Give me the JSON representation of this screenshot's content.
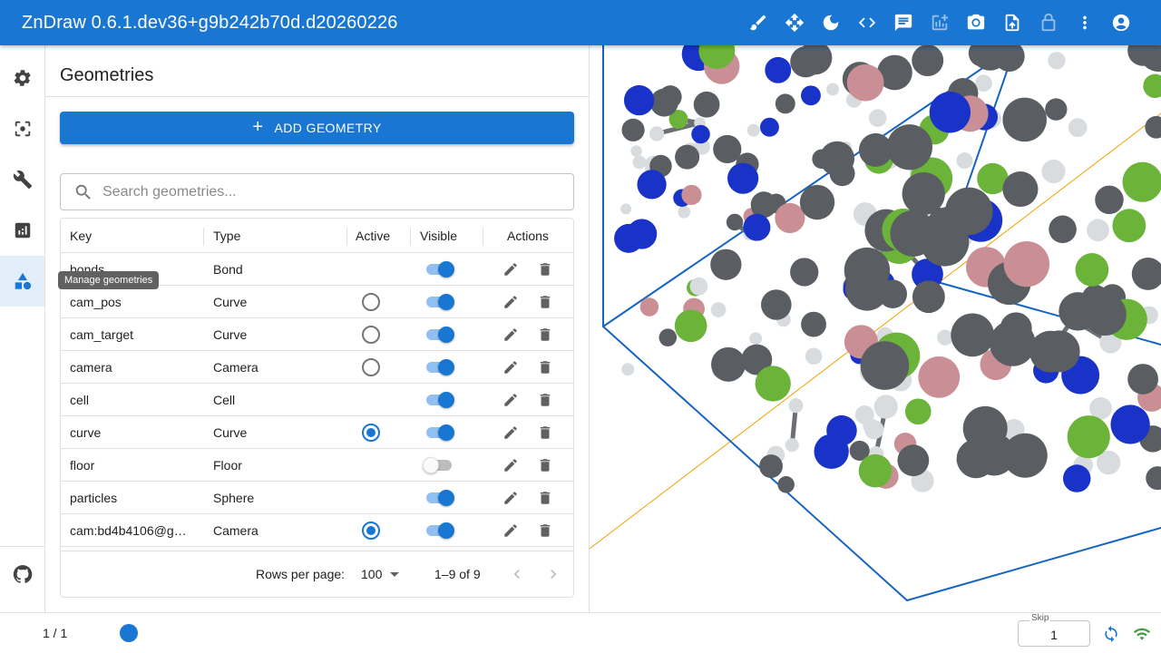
{
  "app": {
    "title": "ZnDraw 0.6.1.dev36+g9b242b70d.d20260226"
  },
  "toolbar": {
    "icons": [
      "brush-icon",
      "move-icon",
      "dark-mode-icon",
      "code-icon",
      "chat-icon",
      "add-chart-icon",
      "camera-icon",
      "upload-icon",
      "lock-icon",
      "more-vert-icon",
      "account-icon"
    ]
  },
  "rail": {
    "items": [
      "settings-icon",
      "center-focus-icon",
      "wrench-icon",
      "analytics-icon",
      "geometries-icon"
    ],
    "active": "geometries-icon",
    "tooltip": "Manage geometries"
  },
  "panel": {
    "title": "Geometries",
    "add_label": "ADD GEOMETRY",
    "search_placeholder": "Search geometries..."
  },
  "table": {
    "columns": {
      "key": "Key",
      "type": "Type",
      "active": "Active",
      "visible": "Visible",
      "actions": "Actions"
    },
    "rows": [
      {
        "key": "bonds",
        "type": "Bond",
        "active": null,
        "visible": true
      },
      {
        "key": "cam_pos",
        "type": "Curve",
        "active": false,
        "visible": true
      },
      {
        "key": "cam_target",
        "type": "Curve",
        "active": false,
        "visible": true
      },
      {
        "key": "camera",
        "type": "Camera",
        "active": false,
        "visible": true
      },
      {
        "key": "cell",
        "type": "Cell",
        "active": null,
        "visible": true
      },
      {
        "key": "curve",
        "type": "Curve",
        "active": true,
        "visible": true
      },
      {
        "key": "floor",
        "type": "Floor",
        "active": null,
        "visible": false
      },
      {
        "key": "particles",
        "type": "Sphere",
        "active": null,
        "visible": true
      },
      {
        "key": "cam:bd4b4106@g…",
        "type": "Camera",
        "active": true,
        "visible": true
      }
    ],
    "footer": {
      "rows_per_page_label": "Rows per page:",
      "rows_per_page": "100",
      "range": "1–9 of 9"
    }
  },
  "bottom": {
    "frame": "1 / 1",
    "progress": 0.0,
    "skip_label": "Skip",
    "skip_value": "1",
    "colors": {
      "sync": "#1976d2",
      "wifi": "#43a047"
    }
  },
  "scene": {
    "atom_colors": {
      "carbon": "#5a5e63",
      "hydrogen": "#d9dcdf",
      "nitrogen": "#1932c8",
      "fluorine": "#6cb33a",
      "boron": "#c98f95"
    },
    "cell_color": "#1565c0",
    "axis_color": "#f0a000"
  }
}
